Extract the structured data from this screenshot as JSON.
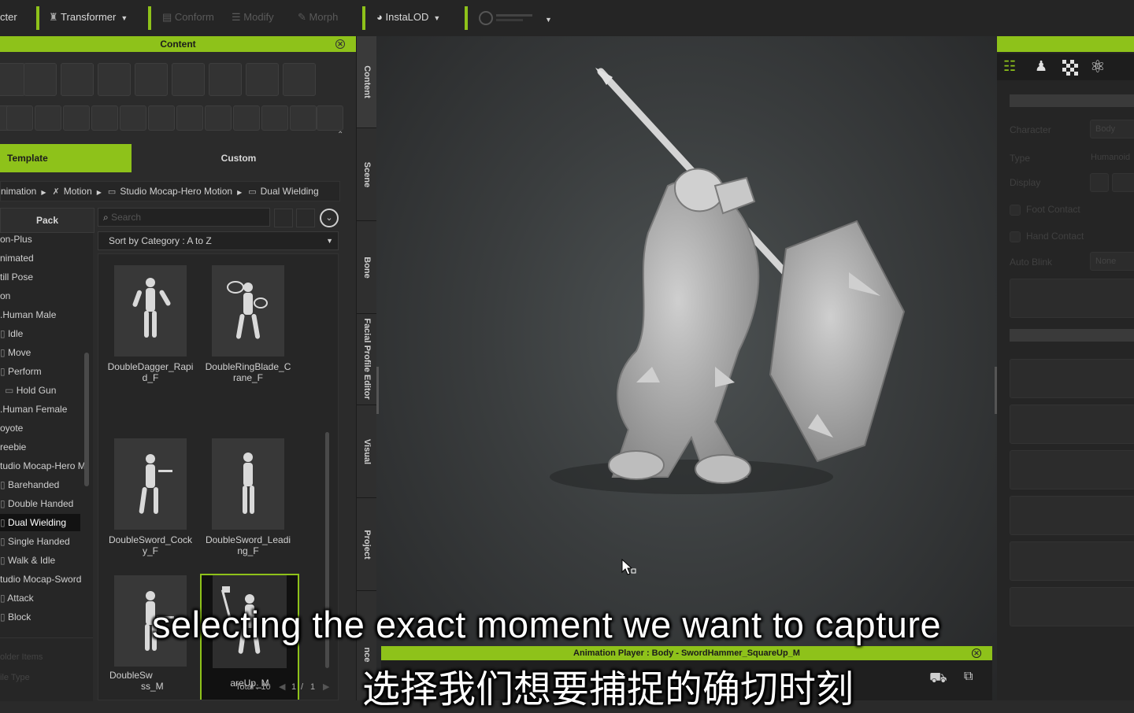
{
  "toolbar": {
    "items": [
      {
        "label": "cter",
        "dim": false
      },
      {
        "label": "Transformer",
        "dim": false
      },
      {
        "label": "Conform",
        "dim": true
      },
      {
        "label": "Modify",
        "dim": true
      },
      {
        "label": "Morph",
        "dim": true
      },
      {
        "label": "InstaLOD",
        "dim": false
      }
    ]
  },
  "content_panel": {
    "title": "Content",
    "tabs": {
      "template": "Template",
      "custom": "Custom"
    },
    "breadcrumb": [
      "nimation",
      "Motion",
      "Studio Mocap-Hero Motion",
      "Dual Wielding"
    ],
    "pack_label": "Pack",
    "search_placeholder": "Search",
    "sort_label": "Sort by Category : A to Z",
    "tree_items": [
      "on-Plus",
      "nimated",
      "till Pose",
      "on",
      ".Human Male",
      "Idle",
      "Move",
      "Perform",
      "Hold Gun",
      ".Human Female",
      "oyote",
      "reebie",
      "tudio Mocap-Hero M",
      "Barehanded",
      "Double Handed",
      "Dual Wielding",
      "Single Handed",
      "Walk & Idle",
      "tudio Mocap-Sword",
      "Attack",
      "Block"
    ],
    "tree_selected": "Dual Wielding",
    "tree_footer": [
      "older Items",
      "ile Type"
    ],
    "thumbnails": [
      {
        "line1": "DoubleDagger_Rapi",
        "line2": "d_F"
      },
      {
        "line1": "DoubleRingBlade_C",
        "line2": "rane_F"
      },
      {
        "line1": "DoubleSword_Cock",
        "line2": "y_F"
      },
      {
        "line1": "DoubleSword_Leadi",
        "line2": "ng_F"
      },
      {
        "line1": "DoubleSw",
        "line2": "ss_M"
      },
      {
        "line1": "",
        "line2": "areUp_M"
      }
    ],
    "footer": {
      "total": "Total : 10",
      "page": "1",
      "sep": "/",
      "pages": "1"
    }
  },
  "side_tabs": [
    "Content",
    "Scene",
    "Bone",
    "Facial Profile Editor",
    "Visual",
    "Project",
    "nce"
  ],
  "right_panel": {
    "rows": [
      {
        "label": "Character",
        "value": "Body"
      },
      {
        "label": "Type",
        "value": "Humanoid"
      },
      {
        "label": "Display",
        "value": ""
      },
      {
        "label": "Foot Contact",
        "value": ""
      },
      {
        "label": "Hand Contact",
        "value": ""
      },
      {
        "label": "Auto Blink",
        "value": "None"
      }
    ]
  },
  "animation_player": {
    "title": "Animation Player : Body - SwordHammer_SquareUp_M"
  },
  "subtitles": {
    "english": "selecting the exact moment we want to capture",
    "chinese": "选择我们想要捕捉的确切时刻"
  },
  "colors": {
    "accent": "#8ec21a",
    "panel": "#2b2b2b",
    "toolbar": "#252525"
  }
}
